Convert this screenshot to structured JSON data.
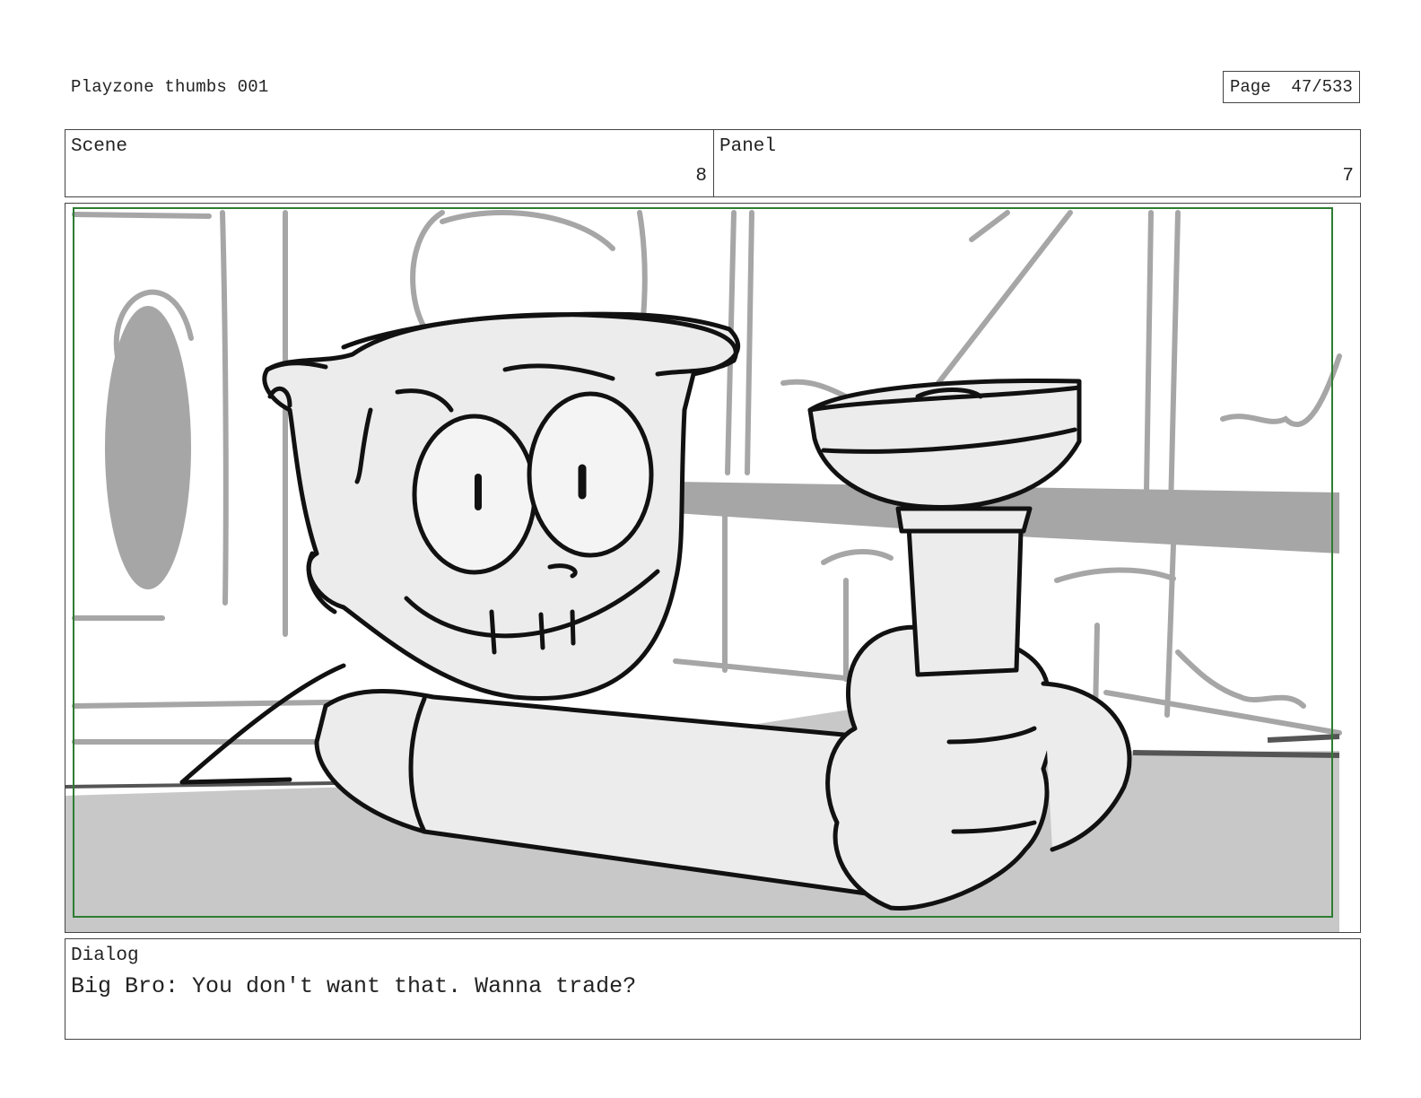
{
  "document": {
    "title": "Playzone thumbs 001",
    "page_label": "Page",
    "page_number": "47/533"
  },
  "header": {
    "scene_label": "Scene",
    "scene_value": "8",
    "panel_label": "Panel",
    "panel_value": "7"
  },
  "frame": {
    "safe_area_color": "#2e7d32",
    "depicts": "storyboard sketch"
  },
  "dialog": {
    "label": "Dialog",
    "text": "Big Bro: You don't want that. Wanna trade?"
  }
}
